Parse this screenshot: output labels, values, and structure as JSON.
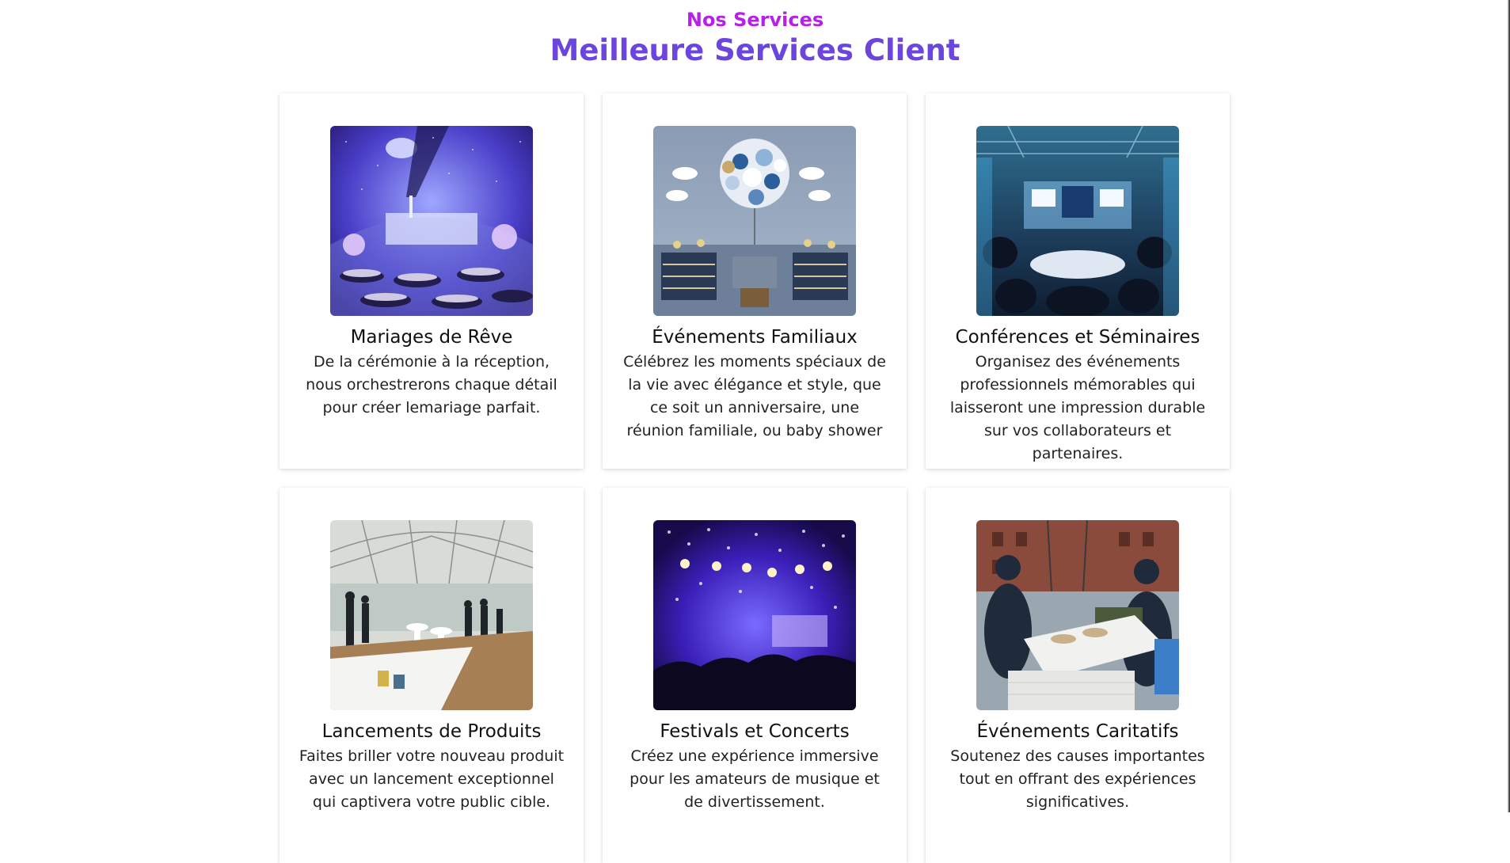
{
  "section": {
    "eyebrow": "Nos Services",
    "title": "Meilleure Services Client"
  },
  "services": [
    {
      "title": "Mariages de Rêve",
      "description": "De la cérémonie à la réception, nous orchestrerons chaque détail pour créer lemariage parfait.",
      "image_icon": "wedding-hall-image"
    },
    {
      "title": "Événements Familiaux",
      "description": "Célébrez les moments spéciaux de la vie avec élégance et style, que ce soit un anniversaire, une réunion familiale, ou baby shower",
      "image_icon": "balloon-party-image"
    },
    {
      "title": "Conférences et Séminaires",
      "description": "Organisez des événements professionnels mémorables qui laisseront une impression durable sur vos collaborateurs et partenaires.",
      "image_icon": "conference-hall-image"
    },
    {
      "title": "Lancements de Produits",
      "description": "Faites briller votre nouveau produit avec un lancement exceptionnel qui captivera votre public cible.",
      "image_icon": "product-launch-image"
    },
    {
      "title": "Festivals et Concerts",
      "description": "Créez une expérience immersive pour les amateurs de musique et de divertissement.",
      "image_icon": "concert-image"
    },
    {
      "title": "Événements Caritatifs",
      "description": "Soutenez des causes importantes tout en offrant des expériences significatives.",
      "image_icon": "charity-event-image"
    }
  ],
  "colors": {
    "eyebrow": "#b521e6",
    "title": "#6b45dd"
  }
}
